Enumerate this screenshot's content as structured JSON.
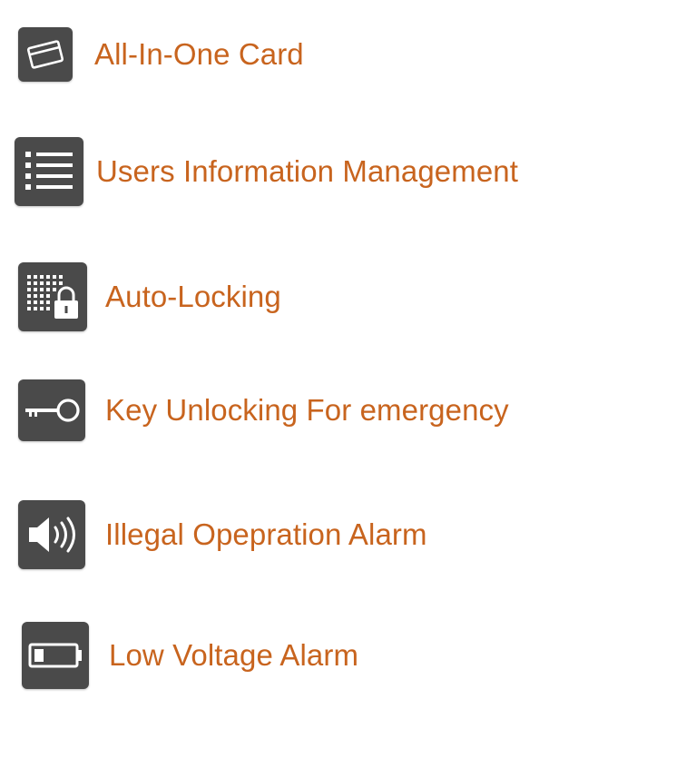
{
  "colors": {
    "label_text": "#c8641e",
    "icon_background": "#4a4a4a",
    "icon_glyph": "#ffffff"
  },
  "features": [
    {
      "icon": "card-icon",
      "label": "All-In-One Card"
    },
    {
      "icon": "list-icon",
      "label": "Users Information Management"
    },
    {
      "icon": "keypad-lock-icon",
      "label": "Auto-Locking"
    },
    {
      "icon": "key-icon",
      "label": "Key Unlocking For emergency"
    },
    {
      "icon": "speaker-icon",
      "label": "Illegal Opepration Alarm"
    },
    {
      "icon": "battery-icon",
      "label": "Low Voltage Alarm"
    }
  ]
}
